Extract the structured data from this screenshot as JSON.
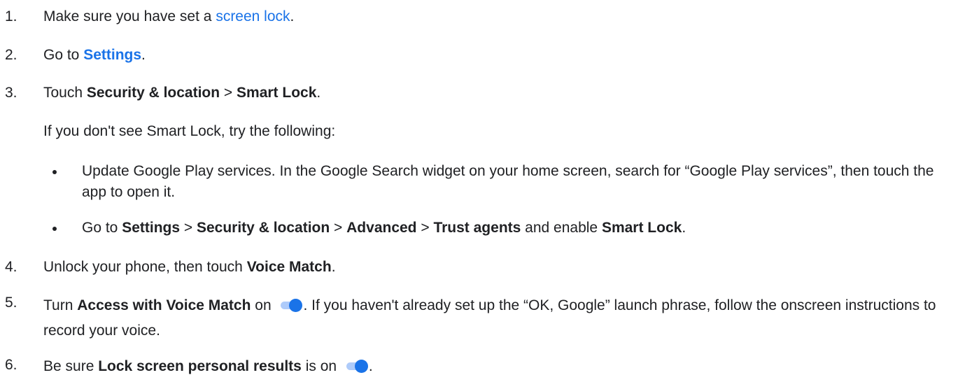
{
  "steps": [
    {
      "n": "1.",
      "t1": "Make sure you have set a ",
      "link": "screen lock",
      "t2": "."
    },
    {
      "n": "2.",
      "t1": "Go to ",
      "link": "Settings",
      "t2": "."
    },
    {
      "n": "3.",
      "t1": "Touch ",
      "b1": "Security & location",
      "t2": " > ",
      "b2": "Smart Lock",
      "t3": ".",
      "note": "If you don't see Smart Lock, try the following:",
      "bullets": [
        {
          "text": "Update Google Play services. In the Google Search widget on your home screen, search for “Google Play services”, then touch the app to open it."
        },
        {
          "t1": "Go to ",
          "b1": "Settings",
          "t2": " > ",
          "b2": "Security & location",
          "t3": " > ",
          "b3": "Advanced",
          "t4": " > ",
          "b4": "Trust agents",
          "t5": " and enable ",
          "b5": "Smart Lock",
          "t6": "."
        }
      ]
    },
    {
      "n": "4.",
      "t1": "Unlock your phone, then touch ",
      "b1": "Voice Match",
      "t2": "."
    },
    {
      "n": "5.",
      "t1": "Turn ",
      "b1": "Access with Voice Match",
      "t2": " on ",
      "t3": ". If you haven't already set up the “OK, Google” launch phrase, follow the onscreen instructions to record your voice."
    },
    {
      "n": "6.",
      "t1": "Be sure ",
      "b1": "Lock screen personal results",
      "t2": " is on ",
      "t3": "."
    }
  ],
  "colors": {
    "link": "#1a73e8",
    "text": "#202124",
    "toggle_knob": "#1a73e8",
    "toggle_track": "#aecbfa"
  },
  "icons": {
    "toggle": "toggle-on-icon"
  }
}
